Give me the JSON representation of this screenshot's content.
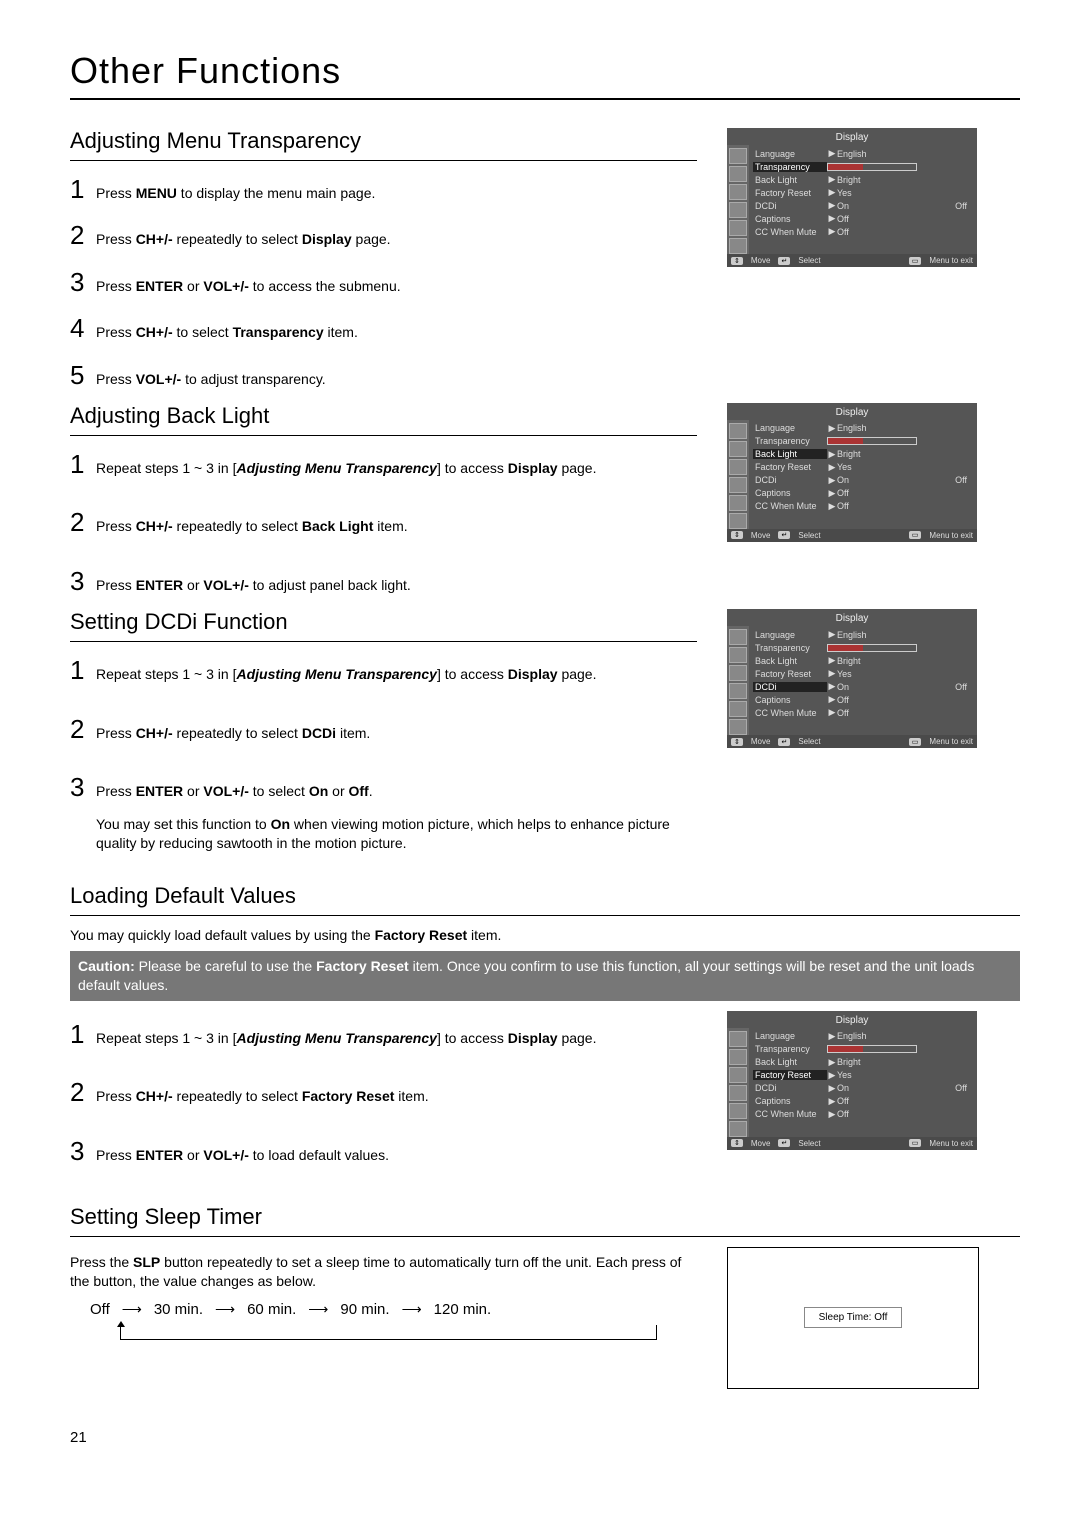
{
  "page_title": "Other Functions",
  "page_number": "21",
  "sections": {
    "transparency": {
      "heading": "Adjusting Menu Transparency",
      "steps": [
        "Press <b>MENU</b> to display the menu main page.",
        "Press <b>CH+/-</b> repeatedly to select <b>Display</b> page.",
        "Press <b>ENTER</b> or <b>VOL+/-</b> to access the submenu.",
        "Press <b>CH+/-</b> to select <b>Transparency</b> item.",
        "Press <b>VOL+/-</b> to adjust transparency."
      ]
    },
    "backlight": {
      "heading": "Adjusting Back Light",
      "steps": [
        "Repeat steps 1 ~ 3 in [<b><i>Adjusting Menu Transparency</i></b>] to access <b>Display</b> page.",
        "Press <b>CH+/-</b> repeatedly to select <b>Back Light</b> item.",
        "Press <b>ENTER</b> or <b>VOL+/-</b> to adjust panel back light."
      ]
    },
    "dcdi": {
      "heading": "Setting DCDi Function",
      "steps": [
        "Repeat steps 1 ~ 3 in [<b><i>Adjusting Menu Transparency</i></b>] to access <b>Display</b> page.",
        "Press <b>CH+/-</b> repeatedly to select <b>DCDi</b> item.",
        "Press <b>ENTER</b> or <b>VOL+/-</b> to select <b>On</b> or <b>Off</b>."
      ],
      "note": "You may set this function to <b>On</b> when viewing motion picture, which helps to enhance picture quality by reducing sawtooth in the motion picture."
    },
    "default": {
      "heading": "Loading Default Values",
      "intro": "You may quickly load default values by using the <b>Factory Reset</b> item.",
      "caution": "<b>Caution:</b> Please be careful to use the <b>Factory Reset</b> item. Once you confirm to use this function, all your settings will be reset and the unit loads default values.",
      "steps": [
        "Repeat steps 1 ~ 3 in [<b><i>Adjusting Menu Transparency</i></b>] to access <b>Display</b> page.",
        "Press <b>CH+/-</b> repeatedly to select <b>Factory Reset</b> item.",
        "Press <b>ENTER</b> or <b>VOL+/-</b> to load default values."
      ]
    },
    "sleep": {
      "heading": "Setting Sleep Timer",
      "intro": "Press the <b>SLP</b> button repeatedly to set a sleep time to automatically turn off the unit. Each press of the button, the value changes as below.",
      "flow": [
        "Off",
        "30 min.",
        "60 min.",
        "90 min.",
        "120 min."
      ],
      "box": "Sleep Time: Off"
    }
  },
  "osd": {
    "title": "Display",
    "footer": {
      "move": "Move",
      "select": "Select",
      "exit": "Menu to exit"
    },
    "rows": [
      {
        "label": "Language",
        "value": "English",
        "slider": false
      },
      {
        "label": "Transparency",
        "value": "",
        "slider": true
      },
      {
        "label": "Back Light",
        "value": "Bright",
        "slider": false
      },
      {
        "label": "Factory Reset",
        "value": "Yes",
        "slider": false
      },
      {
        "label": "DCDi",
        "value": "On",
        "opt": "Off",
        "slider": false
      },
      {
        "label": "Captions",
        "value": "Off",
        "slider": false
      },
      {
        "label": "CC When Mute",
        "value": "Off",
        "slider": false
      }
    ],
    "highlights": {
      "panel1": "Transparency",
      "panel2": "Back Light",
      "panel3": "DCDi",
      "panel4": "Factory Reset"
    }
  }
}
